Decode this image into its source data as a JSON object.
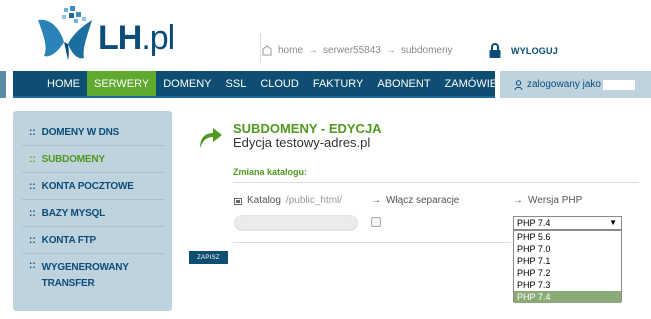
{
  "brand": {
    "name_bold": "LH",
    "name_rest": ".pl"
  },
  "breadcrumb": {
    "items": [
      "home",
      "serwer55843",
      "subdomeny"
    ],
    "separator": "→"
  },
  "logout": {
    "label": "WYLOGUJ"
  },
  "nav": {
    "items": [
      {
        "label": "HOME",
        "active": false
      },
      {
        "label": "SERWERY",
        "active": true
      },
      {
        "label": "DOMENY",
        "active": false
      },
      {
        "label": "SSL",
        "active": false
      },
      {
        "label": "CLOUD",
        "active": false
      },
      {
        "label": "FAKTURY",
        "active": false
      },
      {
        "label": "ABONENT",
        "active": false
      },
      {
        "label": "ZAMÓWIENIE",
        "active": false
      }
    ]
  },
  "user": {
    "label": "zalogowany jako"
  },
  "sidebar": {
    "bullet": "::",
    "items": [
      {
        "label": "DOMENY W DNS",
        "active": false
      },
      {
        "label": "SUBDOMENY",
        "active": true
      },
      {
        "label": "KONTA POCZTOWE",
        "active": false
      },
      {
        "label": "BAZY MYSQL",
        "active": false
      },
      {
        "label": "KONTA FTP",
        "active": false
      },
      {
        "label": "WYGENEROWANY TRANSFER",
        "active": false
      }
    ]
  },
  "main": {
    "title": "SUBDOMENY - EDYCJA",
    "subtitle": "Edycja testowy-adres.pl",
    "section": "Zmiana katalogu:",
    "columns": {
      "catalog_label": "Katalog",
      "catalog_hint": "/public_html/",
      "separator_label": "Włącz separacje",
      "php_label": "Wersja PHP",
      "arrow": "→"
    },
    "catalog_value": "",
    "separator_checked": false,
    "php": {
      "selected": "PHP 7.4",
      "options": [
        "PHP 5.6",
        "PHP 7.0",
        "PHP 7.1",
        "PHP 7.2",
        "PHP 7.3",
        "PHP 7.4"
      ],
      "caret": "▼"
    },
    "save_label": "ZAPISZ"
  },
  "colors": {
    "navy": "#0e4e72",
    "green": "#5fa92f",
    "sidebar_bg": "#bfd3de",
    "logo_blue": "#0b4c78",
    "selected_option": "#8aaa78"
  },
  "icons": [
    "butterfly-logo-icon",
    "home-icon",
    "lock-icon",
    "user-icon",
    "folder-icon",
    "curved-arrow-icon"
  ]
}
